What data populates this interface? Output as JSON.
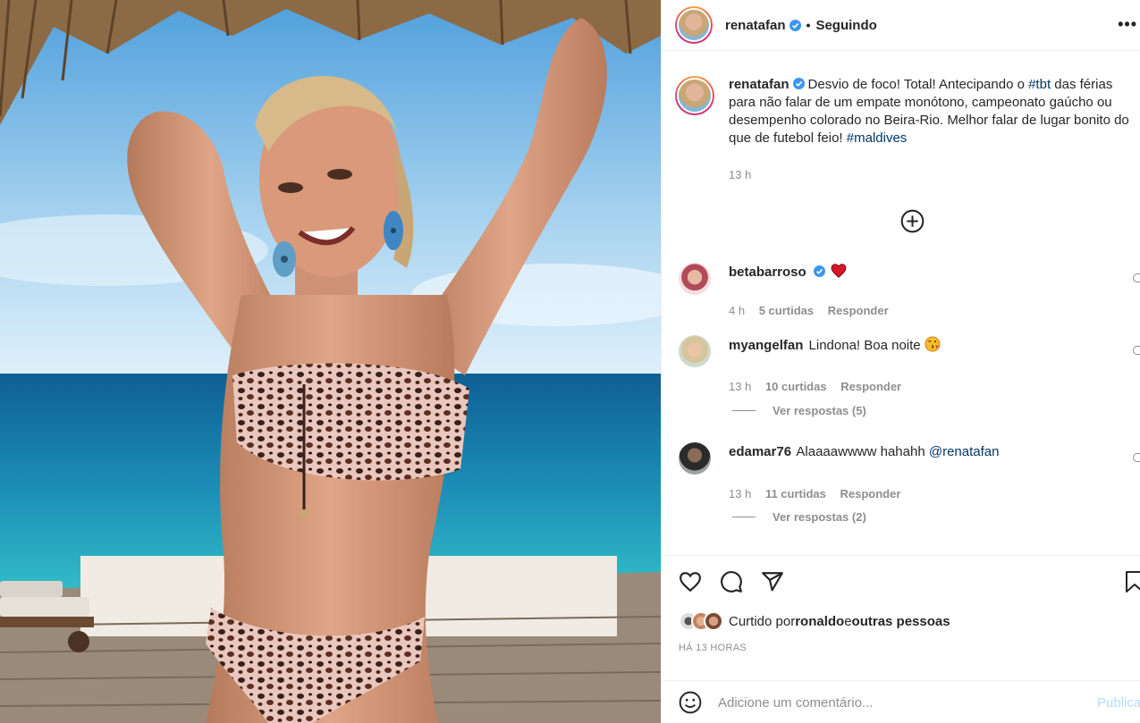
{
  "post": {
    "author": "renatafan",
    "follow_status": "Seguindo",
    "more_label": "•••",
    "caption": {
      "username": "renatafan",
      "text_1": "Desvio de foco! Total! Antecipando o ",
      "tag_1": "#tbt",
      "text_2": " das férias para não falar de um empate monótono, campeonato gaúcho ou desempenho colorado no Beira-Rio. Melhor falar de lugar bonito do que de futebol feio! ",
      "tag_2": "#maldives",
      "time": "13 h"
    }
  },
  "comments": [
    {
      "username": "betabarroso",
      "verified": true,
      "text": "",
      "emoji": "heart",
      "time": "4 h",
      "likes": "5 curtidas",
      "reply": "Responder"
    },
    {
      "username": "myangelfan",
      "verified": false,
      "text": "Lindona! Boa noite",
      "emoji": "kiss-face",
      "time": "13 h",
      "likes": "10 curtidas",
      "reply": "Responder",
      "view_replies": "Ver respostas (5)"
    },
    {
      "username": "edamar76",
      "verified": false,
      "text": "Alaaaawwww hahahh ",
      "mention": "@renatafan",
      "time": "13 h",
      "likes": "11 curtidas",
      "reply": "Responder",
      "view_replies": "Ver respostas (2)"
    }
  ],
  "likes": {
    "prefix": "Curtido por ",
    "user": "ronaldo",
    "mid": " e ",
    "others": "outras pessoas"
  },
  "timestamp": "HÁ 13 HORAS",
  "comment_box": {
    "placeholder": "Adicione um comentário...",
    "publish": "Publicar"
  },
  "icons": [
    "more-icon",
    "verified-badge-icon",
    "add-circle-icon",
    "heart-icon",
    "comment-icon",
    "share-icon",
    "bookmark-icon",
    "emoji-icon"
  ],
  "colors": {
    "link": "#00376b",
    "muted": "#8e8e8e",
    "verified": "#3897f0",
    "publish": "#b3dbff"
  }
}
